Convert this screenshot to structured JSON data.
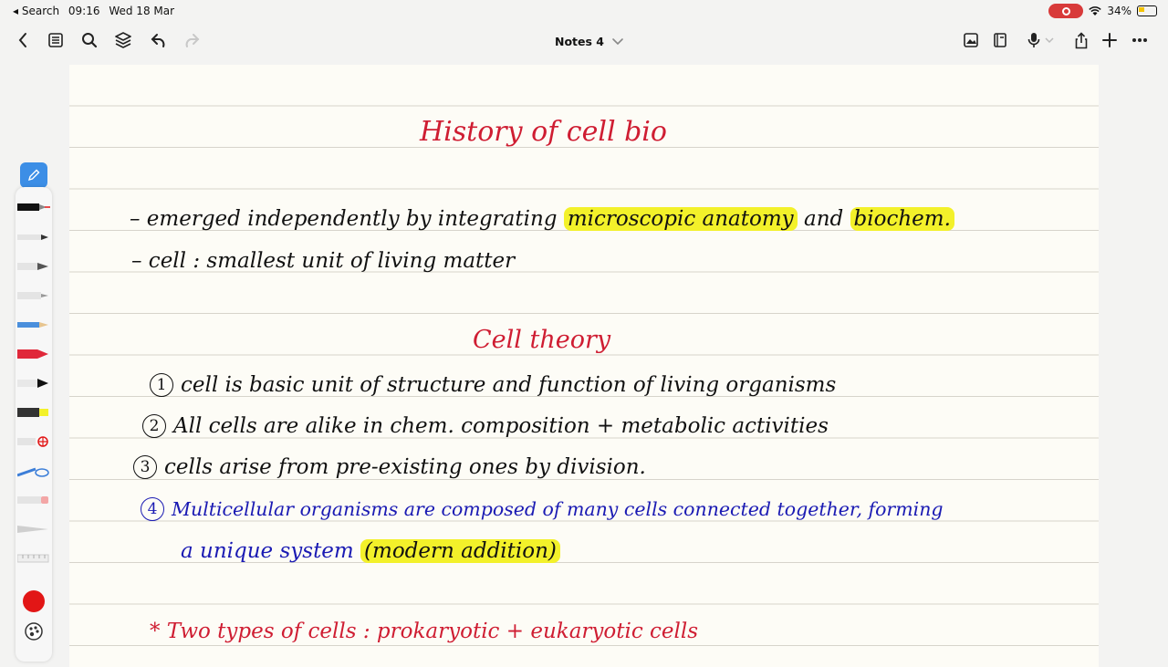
{
  "status_bar": {
    "back_app": "◂ Search",
    "time": "09:16",
    "date": "Wed 18 Mar",
    "battery": "34%"
  },
  "toolbar": {
    "document_title": "Notes 4"
  },
  "note": {
    "title": "History of cell bio",
    "bullet_1_prefix": "– emerged  independently by integrating ",
    "bullet_1_hl1": "microscopic anatomy",
    "bullet_1_mid": " and ",
    "bullet_1_hl2": "biochem.",
    "bullet_2": "– cell : smallest unit of living matter",
    "subtitle": "Cell theory",
    "point_1_num": "1",
    "point_1": "cell is basic unit of structure and function of living organisms",
    "point_2_num": "2",
    "point_2": "All cells are alike in chem. composition + metabolic activities",
    "point_3_num": "3",
    "point_3": "cells arise from pre-existing ones by division.",
    "point_4_num": "4",
    "point_4_line1": "Multicellular organisms are composed of many cells connected together, forming",
    "point_4_line2_prefix": "a unique system ",
    "point_4_hl": "(modern addition)",
    "footer_line": "* Two types of cells : prokaryotic + eukaryotic cells"
  },
  "tools": {
    "selected_color": "#e21616",
    "highlighter_color": "#f3f12a"
  }
}
